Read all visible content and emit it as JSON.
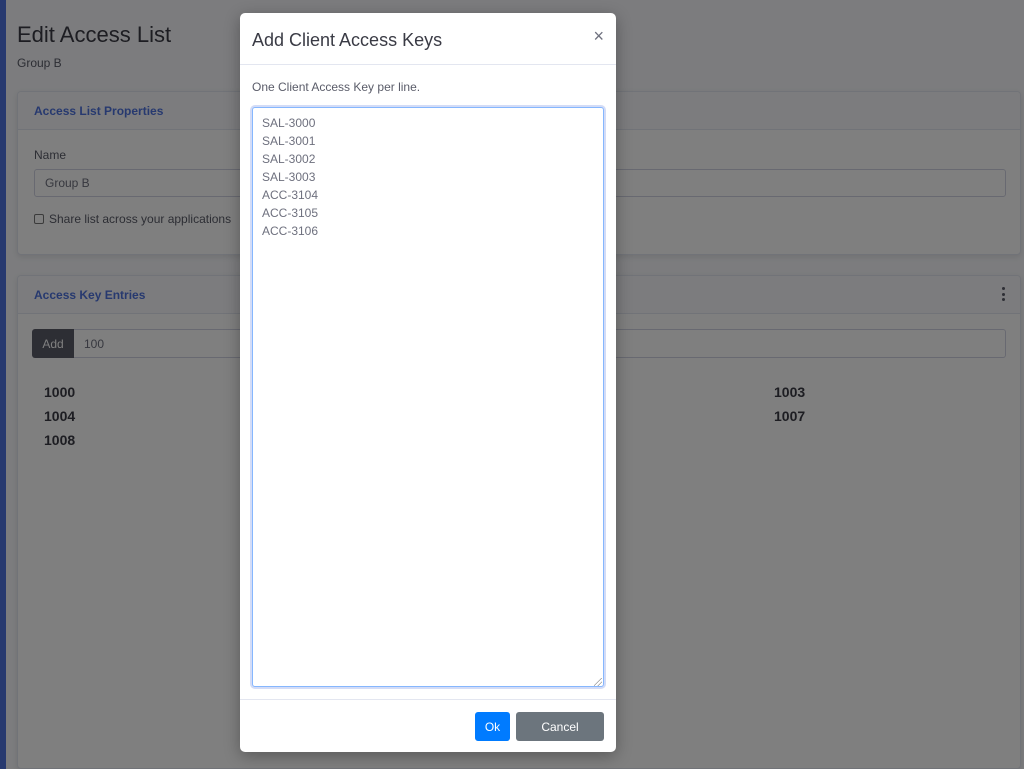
{
  "page": {
    "title": "Edit Access List",
    "subtitle": "Group B"
  },
  "properties_card": {
    "header": "Access List Properties",
    "name_label": "Name",
    "name_value": "Group B",
    "share_label": "Share list across your applications",
    "share_checked": false
  },
  "entries_card": {
    "header": "Access Key Entries",
    "menu_icon": "vertical-ellipsis-icon",
    "add_label": "Add",
    "add_input_value": "100",
    "entries": [
      "1000",
      "1003",
      "1004",
      "1007",
      "1008"
    ]
  },
  "modal": {
    "title": "Add Client Access Keys",
    "close_glyph": "×",
    "help_text": "One Client Access Key per line.",
    "keys_text": "SAL-3000\nSAL-3001\nSAL-3002\nSAL-3003\nACC-3104\nACC-3105\nACC-3106",
    "ok_label": "Ok",
    "cancel_label": "Cancel"
  },
  "colors": {
    "accent": "#4e73df",
    "primary_button": "#007bff",
    "secondary_button": "#6c757d",
    "backdrop": "rgba(0,0,0,0.5)"
  }
}
